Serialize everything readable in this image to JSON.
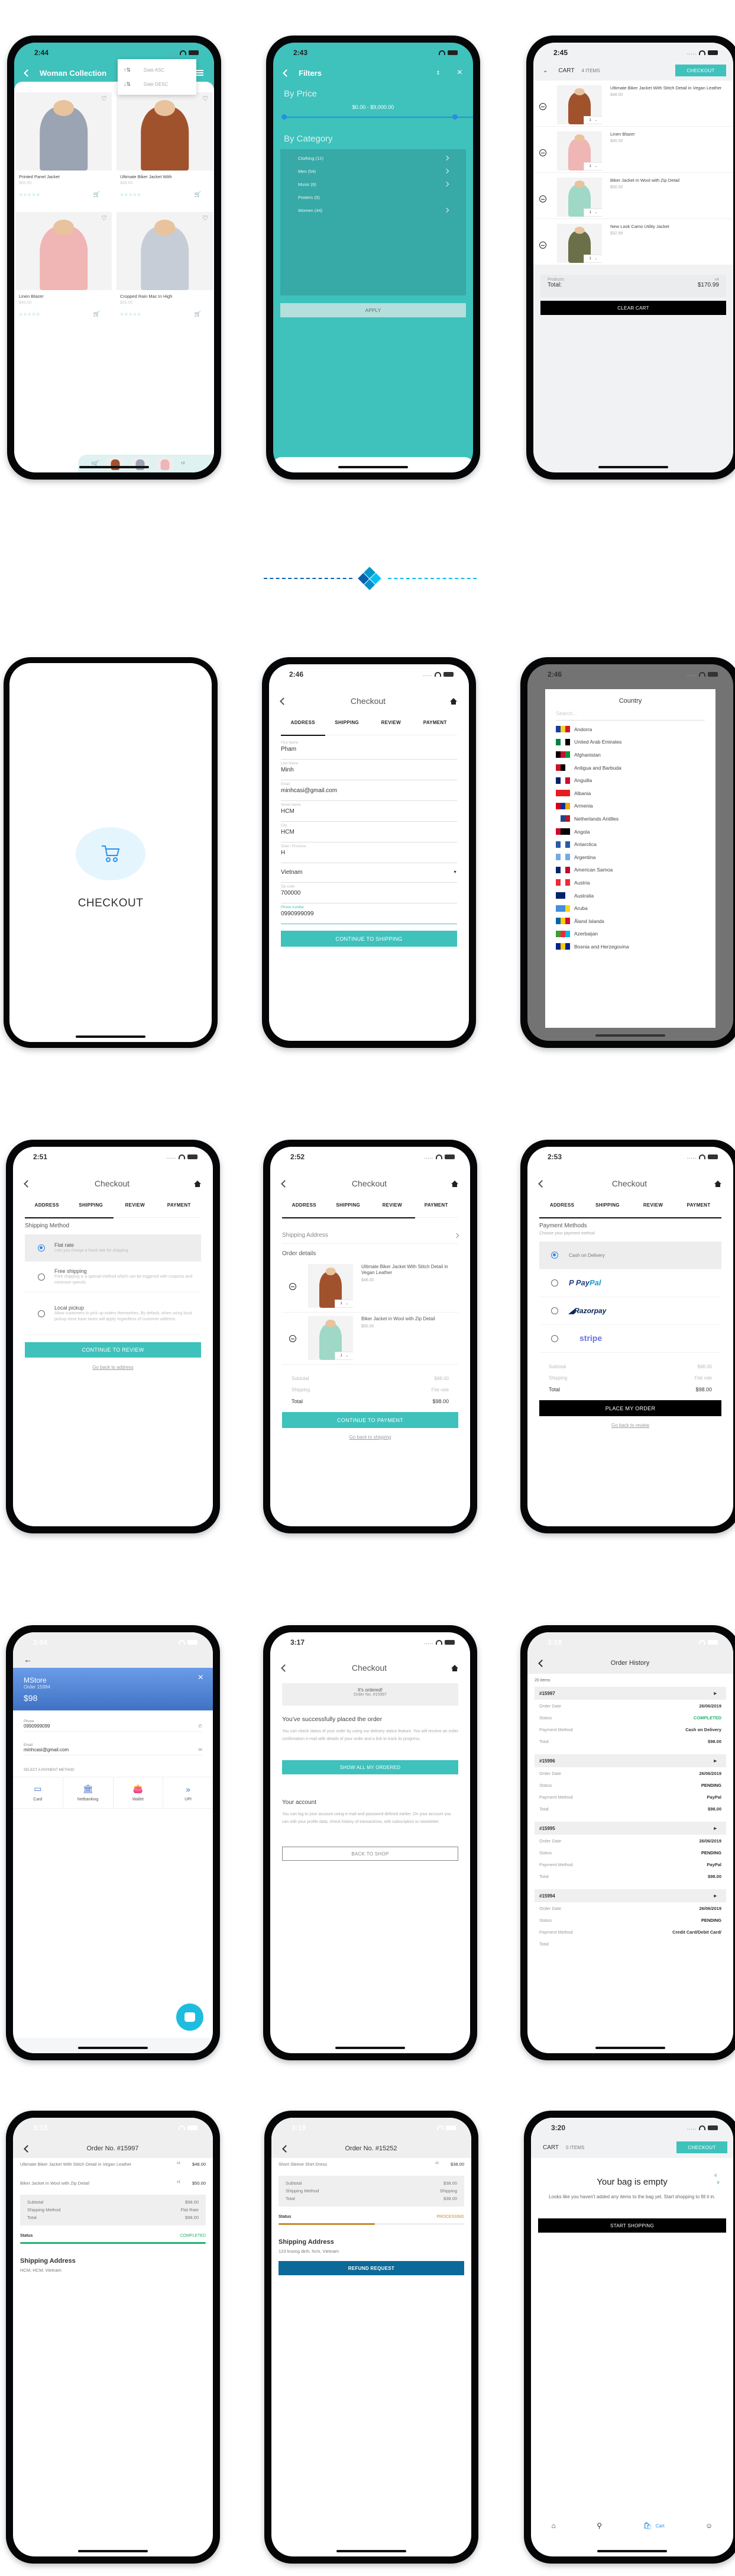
{
  "colors": {
    "brand": "#3fc1bc",
    "completed": "#21b36b",
    "processing": "#c98a2c",
    "refund": "#0b6a99",
    "razorpay_blue": "#4b7ad8",
    "stripe": "#6772e5"
  },
  "screen1": {
    "time": "2:44",
    "title": "Woman Collection",
    "sort_menu": [
      {
        "icon": "sort-asc-icon",
        "label": "Date ASC"
      },
      {
        "icon": "sort-desc-icon",
        "label": "Date DESC"
      }
    ],
    "products": [
      {
        "name": "Printed Panel Jacket",
        "price": "$60.00",
        "rating": 0
      },
      {
        "name": "Ultimate Biker Jacket With",
        "price": "$48.00",
        "rating": 0
      },
      {
        "name": "Linen Blazer",
        "price": "$40.00",
        "rating": 0
      },
      {
        "name": "Cropped Rain Mac In High",
        "price": "$35.00",
        "rating": 0
      }
    ],
    "mini_cart_more": "+2"
  },
  "screen2": {
    "time": "2:43",
    "title": "Filters",
    "price_heading": "By Price",
    "price_range": "$0.00 - $9,000.00",
    "price_min": 0,
    "price_max": 9000,
    "category_heading": "By Category",
    "categories": [
      {
        "label": "Clothing (12)",
        "has_children": true
      },
      {
        "label": "Men (54)",
        "has_children": true
      },
      {
        "label": "Music (6)",
        "has_children": true
      },
      {
        "label": "Posters (5)",
        "has_children": false
      },
      {
        "label": "Women (44)",
        "has_children": true
      }
    ],
    "apply": "APPLY"
  },
  "screen3": {
    "time": "2:45",
    "cart": "CART",
    "items_count": "4 ITEMS",
    "checkout": "CHECKOUT",
    "items": [
      {
        "name": "Ultimate Biker Jacket With Stitch Detail in Vegan Leather",
        "price": "$48.00",
        "qty": "1"
      },
      {
        "name": "Linen Blazer",
        "price": "$40.00",
        "qty": "1"
      },
      {
        "name": "Biker Jacket in Wool with Zip Detail",
        "price": "$50.00",
        "qty": "1"
      },
      {
        "name": "New Look Camo Utility Jacket",
        "price": "$32.99",
        "qty": "1"
      }
    ],
    "products_label": "Products",
    "products_count": "x4",
    "total_label": "Total:",
    "total": "$170.99",
    "clear": "CLEAR CART"
  },
  "splash": {
    "label": "CHECKOUT"
  },
  "checkout_tabs": [
    "ADDRESS",
    "SHIPPING",
    "REVIEW",
    "PAYMENT"
  ],
  "checkout_title": "Checkout",
  "address": {
    "time": "2:46",
    "fields": [
      {
        "label": "First Name",
        "value": "Pham"
      },
      {
        "label": "Last Name",
        "value": "Minh"
      },
      {
        "label": "Email",
        "value": "minhcasi@gmail.com"
      },
      {
        "label": "Street Name",
        "value": "HCM"
      },
      {
        "label": "City",
        "value": "HCM"
      },
      {
        "label": "State / Province",
        "value": "H"
      }
    ],
    "country": "Vietnam",
    "zip": {
      "label": "Zip-code",
      "value": "700000"
    },
    "phone": {
      "label": "Phone number",
      "value": "0990999099"
    },
    "continue": "CONTINUE TO SHIPPING"
  },
  "country_modal": {
    "time": "2:46",
    "title": "Country",
    "search_placeholder": "Search...",
    "countries": [
      "Andorra",
      "United Arab Emirates",
      "Afghanistan",
      "Antigua and Barbuda",
      "Anguilla",
      "Albania",
      "Armenia",
      "Netherlands Antilles",
      "Angola",
      "Antarctica",
      "Argentina",
      "American Samoa",
      "Austria",
      "Australia",
      "Aruba",
      "Åland Islands",
      "Azerbaijan",
      "Bosnia and Herzegovina"
    ]
  },
  "shipping": {
    "time": "2:51",
    "heading": "Shipping Method",
    "methods": [
      {
        "name": "Flat rate",
        "desc": "Lets you charge a fixed rate for shipping.",
        "selected": true
      },
      {
        "name": "Free shipping",
        "desc": "Free shipping is a special method which can be triggered with coupons and minimum spends.",
        "selected": false
      },
      {
        "name": "Local pickup",
        "desc": "Allow customers to pick up orders themselves. By default, when using local pickup store base taxes will apply regardless of customer address.",
        "selected": false
      }
    ],
    "continue": "CONTINUE TO REVIEW",
    "back": "Go back to address"
  },
  "review": {
    "time": "2:52",
    "shipping_address": "Shipping Address",
    "order_details": "Order details",
    "items": [
      {
        "name": "Ultimate Biker Jacket With Stitch Detail in Vegan Leather",
        "price": "$48.00",
        "qty": "1"
      },
      {
        "name": "Biker Jacket in Wool with Zip Detail",
        "price": "$50.00",
        "qty": "1"
      }
    ],
    "subtotal_label": "Subtotal",
    "subtotal": "$98.00",
    "shipping_label": "Shipping",
    "shipping": "Flat rate",
    "total_label": "Total",
    "total": "$98.00",
    "continue": "CONTINUE TO PAYMENT",
    "back": "Go back to shipping"
  },
  "payment": {
    "time": "2:53",
    "heading": "Payment Methods",
    "sub": "Choose your payment method",
    "methods": [
      {
        "name": "Cash on Delivery",
        "selected": true
      },
      {
        "name": "PayPal",
        "selected": false
      },
      {
        "name": "Razorpay",
        "selected": false
      },
      {
        "name": "stripe",
        "selected": false
      }
    ],
    "subtotal_label": "Subtotal",
    "subtotal": "$98.00",
    "shipping_label": "Shipping",
    "shipping": "Flat rate",
    "total_label": "Total",
    "total": "$98.00",
    "place": "PLACE MY ORDER",
    "back": "Go back to review"
  },
  "razorpay": {
    "time": "3:04",
    "store": "MStore",
    "order": "Order 15994",
    "amount": "$98",
    "phone_label": "Phone",
    "phone": "0990999099",
    "email_label": "Email",
    "email": "minhcasi@gmail.com",
    "select": "SELECT A PAYMENT METHOD",
    "methods": [
      {
        "icon": "card-icon",
        "label": "Card"
      },
      {
        "icon": "bank-icon",
        "label": "Netbanking"
      },
      {
        "icon": "wallet-icon",
        "label": "Wallet"
      },
      {
        "icon": "upi-icon",
        "label": "UPI"
      }
    ]
  },
  "success": {
    "time": "3:17",
    "ordered": "It's ordered!",
    "order_no": "Order No.  #15997",
    "heading": "You've successfully placed the order",
    "text": "You can check status of your order by using our delivery status feature. You will receive an order confirmation e-mail with details of your order and a link to track its progress.",
    "show_orders": "SHOW ALL MY ORDERED",
    "account_heading": "Your account",
    "account_text": "You can log to your account using e-mail and password defined earlier. On your account you can edit your profile data, check history of transactions, edit subscription to newsletter.",
    "back_shop": "BACK TO SHOP"
  },
  "history": {
    "time": "3:18",
    "title": "Order History",
    "count": "20 items",
    "labels": {
      "date": "Order Date",
      "status": "Status",
      "method": "Payment Method",
      "total": "Total"
    },
    "orders": [
      {
        "id": "#15997",
        "date": "26/06/2019",
        "status": "COMPLETED",
        "method": "Cash on Delivery",
        "total": "$98.00"
      },
      {
        "id": "#15996",
        "date": "26/06/2019",
        "status": "PENDING",
        "method": "PayPal",
        "total": "$98.00"
      },
      {
        "id": "#15995",
        "date": "26/06/2019",
        "status": "PENDING",
        "method": "PayPal",
        "total": "$98.00"
      },
      {
        "id": "#15994",
        "date": "26/06/2019",
        "status": "PENDING",
        "method": "Credit Card/Debit Card/",
        "total": ""
      }
    ]
  },
  "order1": {
    "time": "3:18",
    "title": "Order No. #15997",
    "items": [
      {
        "name": "Ultimate Biker Jacket With Stitch Detail in Vegan Leather",
        "qty": "x1",
        "price": "$48.00"
      },
      {
        "name": "Biker Jacket in Wool with Zip Detail",
        "qty": "x1",
        "price": "$50.00"
      }
    ],
    "subtotal_label": "Subtotal",
    "subtotal": "$98.00",
    "method_label": "Shipping Method",
    "method": "Flat Rate",
    "total_label": "Total",
    "total": "$98.00",
    "status_label": "Status",
    "status": "COMPLETED",
    "progress": 1.0,
    "addr_heading": "Shipping Address",
    "addr": "HCM, HCM, Vietnam"
  },
  "order2": {
    "time": "3:19",
    "title": "Order No. #15252",
    "items": [
      {
        "name": "Short Sleeve Shirt Dress",
        "qty": "x1",
        "price": "$38.00"
      }
    ],
    "subtotal_label": "Subtotal",
    "subtotal": "$38.00",
    "method_label": "Shipping Method",
    "method": "Shipping",
    "total_label": "Total",
    "total": "$38.00",
    "status_label": "Status",
    "status": "PROCESSING",
    "progress": 0.52,
    "addr_heading": "Shipping Address",
    "addr": "123 truong dinh, hcm, Vietnam",
    "refund": "REFUND REQUEST"
  },
  "empty": {
    "time": "3:20",
    "cart": "CART",
    "items_count": "0 ITEMS",
    "checkout": "CHECKOUT",
    "heading": "Your bag is empty",
    "text": "Looks like you haven't added any items to the bag yet. Start shopping to fill it in.",
    "start": "START SHOPPING",
    "nav": [
      {
        "icon": "home-icon",
        "label": ""
      },
      {
        "icon": "search-icon",
        "label": ""
      },
      {
        "icon": "cart-icon",
        "label": "Cart"
      },
      {
        "icon": "user-icon",
        "label": ""
      }
    ]
  }
}
